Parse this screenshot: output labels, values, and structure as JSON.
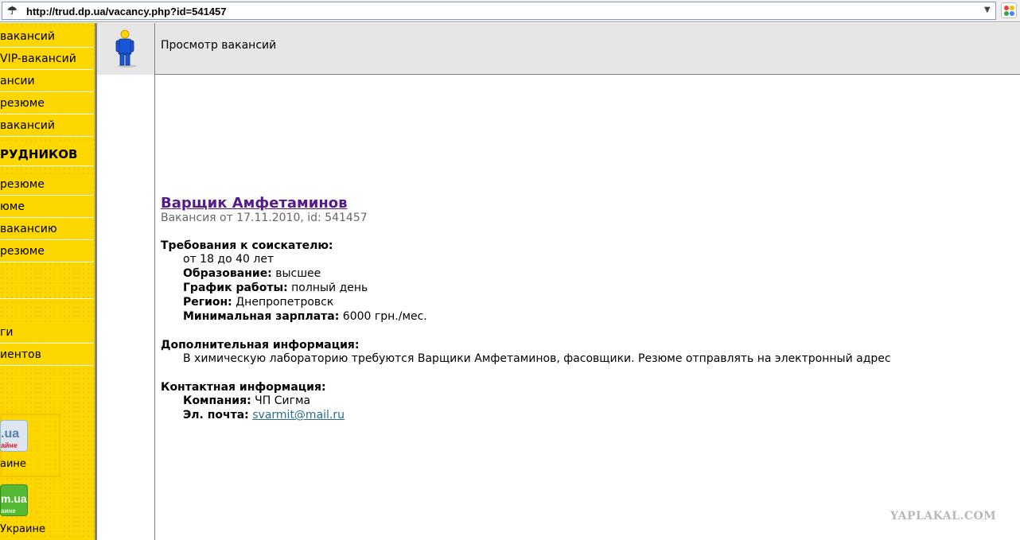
{
  "browser": {
    "url": "http://trud.dp.ua/vacancy.php?id=541457"
  },
  "sidebar": {
    "items": [
      {
        "label": "вакансий"
      },
      {
        "label": "VIP-вакансий"
      },
      {
        "label": "ансии"
      },
      {
        "label": "резюме"
      },
      {
        "label": "вакансий"
      }
    ],
    "heading": "РУДНИКОВ",
    "items2": [
      {
        "label": "резюме"
      },
      {
        "label": "юме"
      },
      {
        "label": "вакансию"
      },
      {
        "label": "резюме"
      }
    ],
    "items3": [
      {
        "label": "ги"
      },
      {
        "label": "иентов"
      }
    ],
    "promo1": {
      "logo": ".ua",
      "sub": "айне",
      "caption": "аине"
    },
    "promo2": {
      "logo": "m.ua",
      "sub": "аине",
      "caption": "Украине"
    }
  },
  "header": {
    "title": "Просмотр вакансий"
  },
  "vacancy": {
    "title": "Варщик Амфетаминов",
    "meta": "Вакансия от 17.11.2010, id: 541457",
    "requirements": {
      "title": "Требования к соискателю:",
      "age": "от 18 до 40 лет",
      "education_label": "Образование:",
      "education": "высшее",
      "schedule_label": "График работы:",
      "schedule": "полный день",
      "region_label": "Регион:",
      "region": "Днепропетровск",
      "salary_label": "Минимальная зарплата:",
      "salary": "6000 грн./мес."
    },
    "additional": {
      "title": "Дополнительная информация:",
      "text": "В химическую лабораторию требуются Варщики Амфетаминов, фасовщики. Резюме отправлять на электронный адрес"
    },
    "contact": {
      "title": "Контактная информация:",
      "company_label": "Компания:",
      "company": "ЧП Сигма",
      "email_label": "Эл. почта:",
      "email": "svarmit@mail.ru"
    }
  },
  "watermark": "YAPLAKAL.COM"
}
